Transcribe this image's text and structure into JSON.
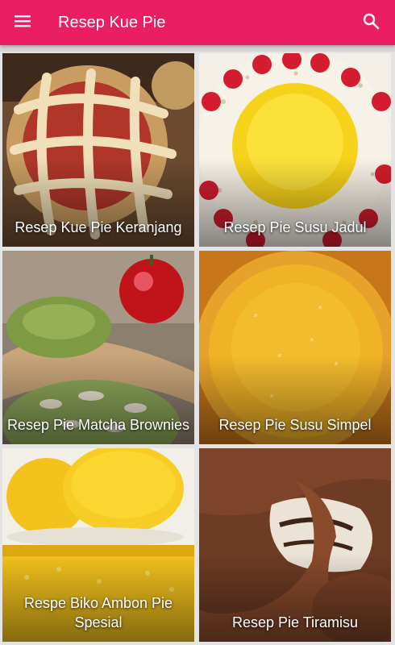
{
  "app": {
    "title": "Resep Kue Pie",
    "menu_icon": "hamburger-menu-icon",
    "search_icon": "search-icon",
    "accent_color": "#e91e63"
  },
  "recipes": [
    {
      "label": "Resep Kue Pie Keranjang"
    },
    {
      "label": "Resep Pie Susu Jadul"
    },
    {
      "label": "Resep Pie Matcha Brownies"
    },
    {
      "label": "Resep Pie Susu Simpel"
    },
    {
      "label": "Respe Biko Ambon Pie Spesial"
    },
    {
      "label": "Resep Pie Tiramisu"
    }
  ]
}
